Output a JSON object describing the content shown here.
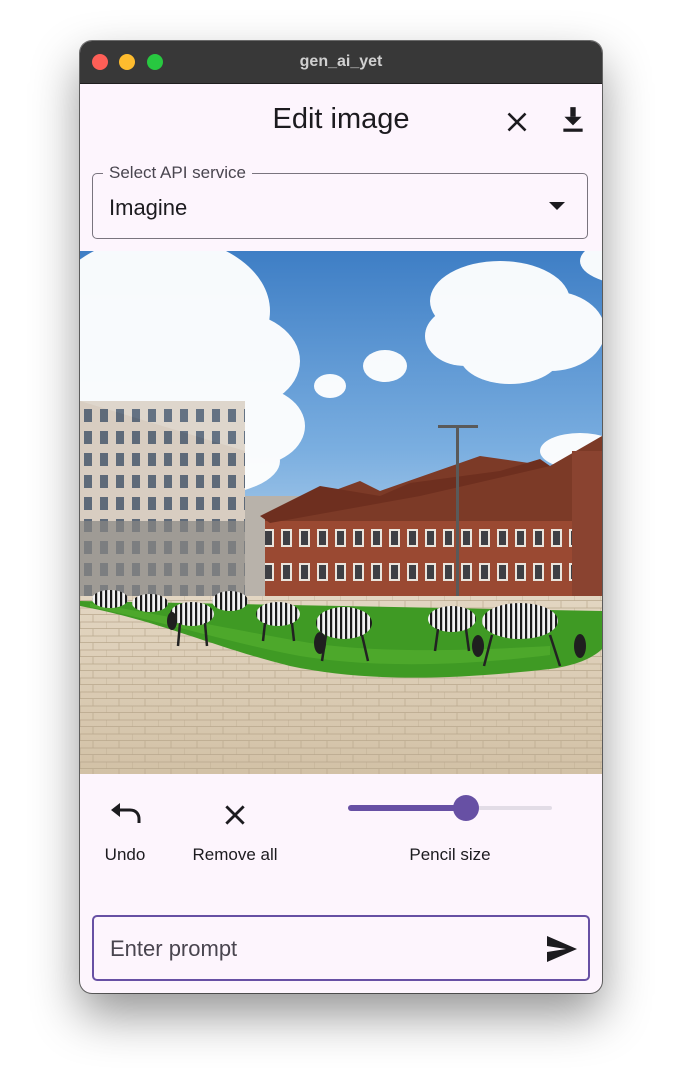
{
  "window": {
    "title": "gen_ai_yet"
  },
  "appbar": {
    "title": "Edit image",
    "close_icon": "close-icon",
    "download_icon": "download-icon"
  },
  "api_select": {
    "label": "Select API service",
    "value": "Imagine"
  },
  "image": {
    "description_icon": "image-canvas"
  },
  "tools": {
    "undo_label": "Undo",
    "remove_all_label": "Remove all",
    "pencil_size_label": "Pencil size",
    "pencil_size_fraction": 0.58
  },
  "prompt": {
    "placeholder": "Enter prompt",
    "value": ""
  },
  "colors": {
    "accent": "#6750a4",
    "surface": "#fdf5fd",
    "titlebar": "#383838"
  }
}
